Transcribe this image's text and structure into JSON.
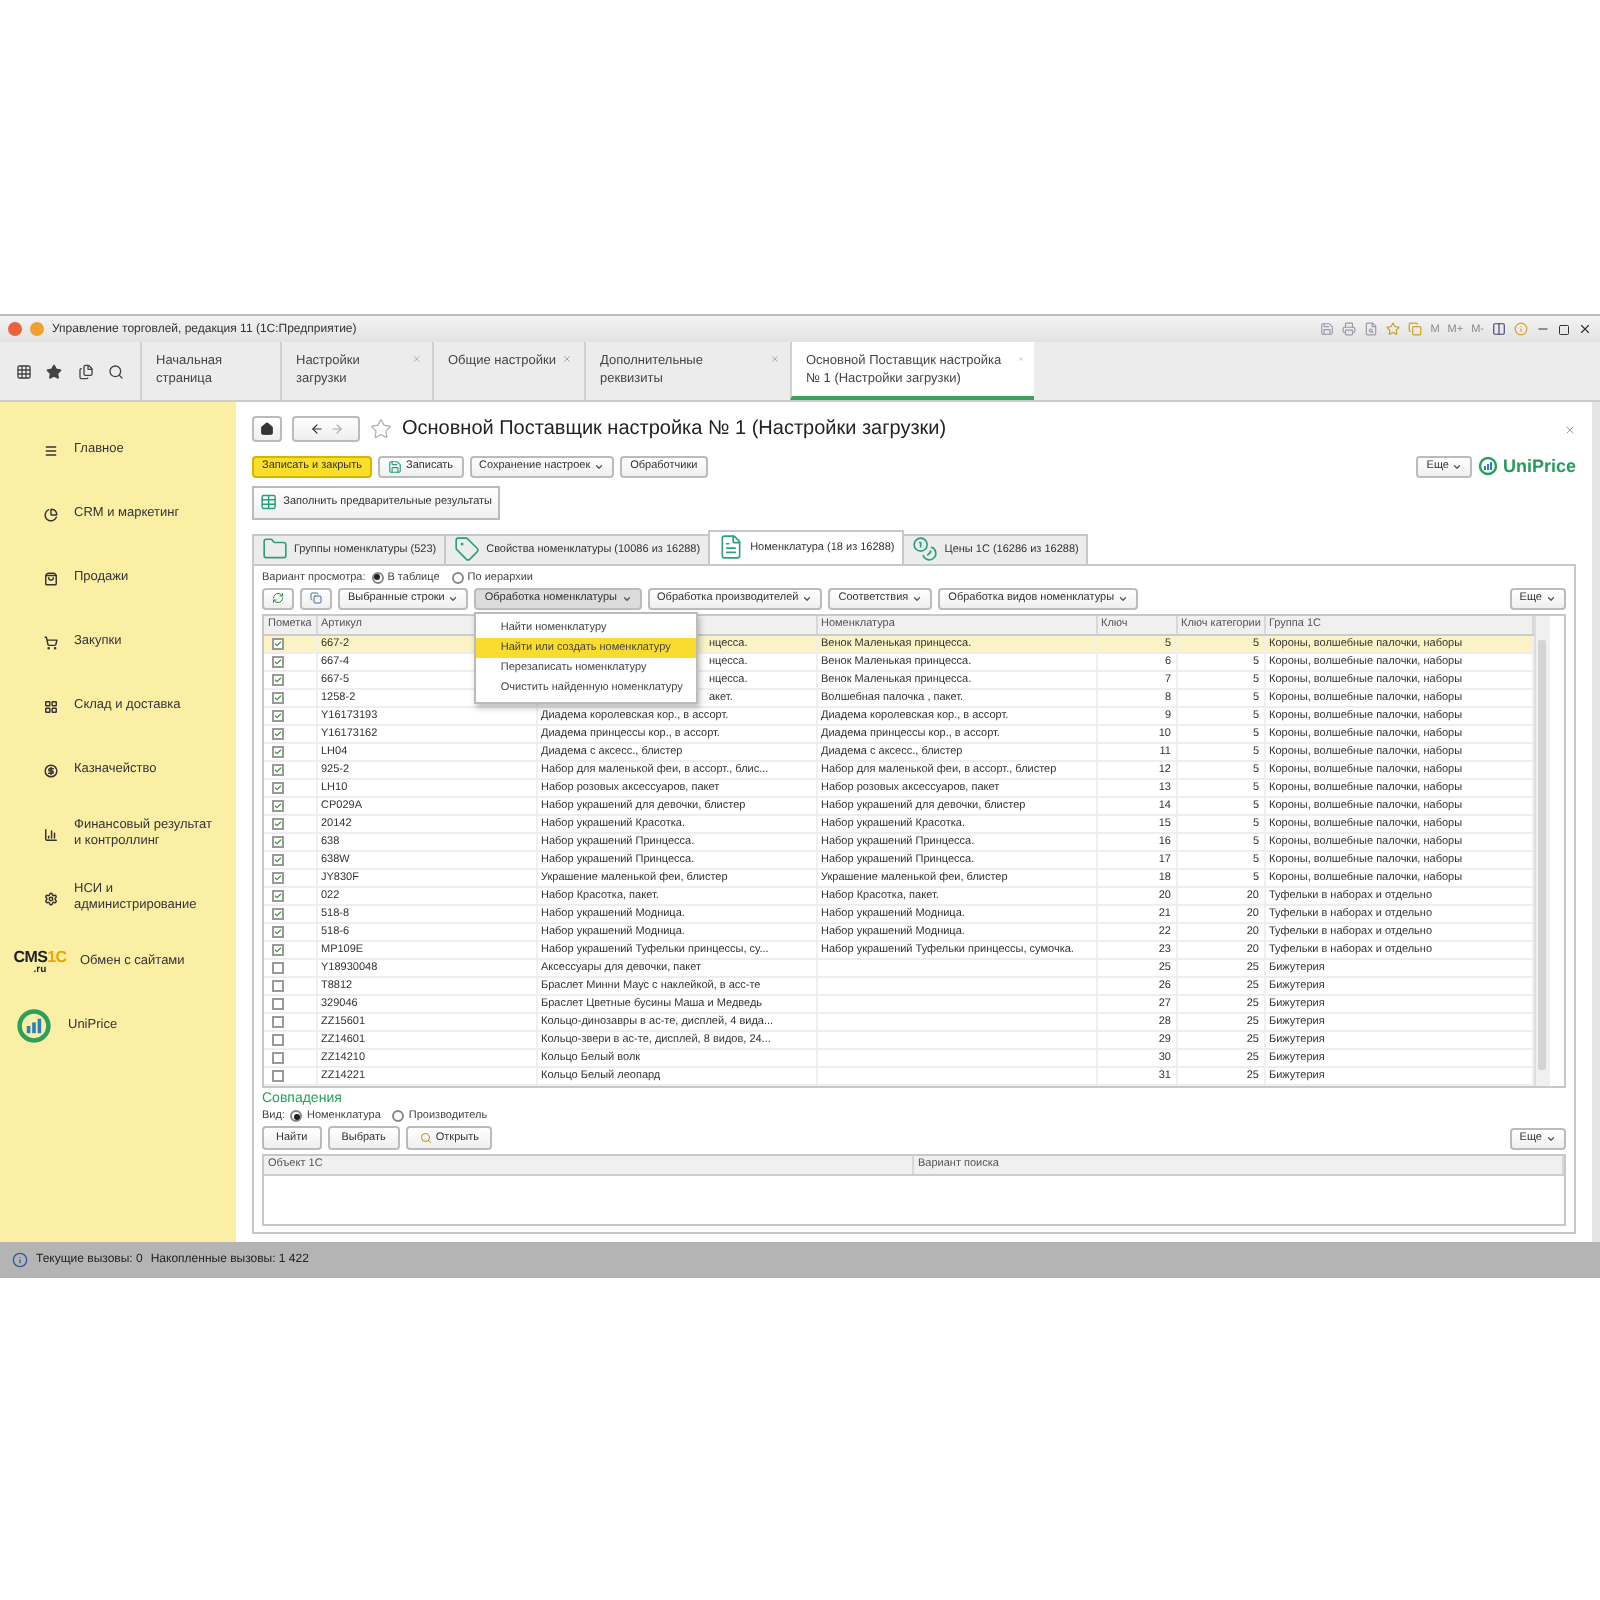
{
  "window": {
    "title": "Управление торговлей, редакция 11 (1С:Предприятие)",
    "memory_buttons": [
      "M",
      "M+",
      "M-"
    ]
  },
  "tabs": [
    {
      "label": "Начальная страница",
      "closable": false,
      "selected": false
    },
    {
      "label": "Настройки загрузки",
      "closable": true,
      "selected": false
    },
    {
      "label": "Общие настройки",
      "closable": true,
      "selected": false
    },
    {
      "label": "Дополнительные реквизиты",
      "closable": true,
      "selected": false
    },
    {
      "label": "Основной Поставщик настройка № 1 (Настройки загрузки)",
      "closable": true,
      "selected": true
    }
  ],
  "sidebar": {
    "items": [
      {
        "kind": "section",
        "label": "Главное"
      },
      {
        "kind": "section",
        "label": "CRM и маркетинг"
      },
      {
        "kind": "section",
        "label": "Продажи"
      },
      {
        "kind": "section",
        "label": "Закупки"
      },
      {
        "kind": "section",
        "label": "Склад и доставка"
      },
      {
        "kind": "section",
        "label": "Казначейство"
      },
      {
        "kind": "section",
        "label": "Финансовый результат и контроллинг"
      },
      {
        "kind": "section",
        "label": "НСИ и администрирование"
      },
      {
        "kind": "cms-logo",
        "label": "Обмен с сайтами",
        "logo": {
          "main": "CMS",
          "accent": "1C",
          "sub": ".ru"
        }
      },
      {
        "kind": "uniprice-logo",
        "label": "UniPrice"
      }
    ]
  },
  "form": {
    "title": "Основной Поставщик настройка № 1 (Настройки загрузки)",
    "toolbar": {
      "buttons": [
        {
          "kind": "primary",
          "label": "Записать и закрыть"
        },
        {
          "kind": "save",
          "label": "Записать"
        },
        {
          "kind": "dropdown",
          "label": "Сохранение настроек"
        },
        {
          "kind": "plain",
          "label": "Обработчики"
        }
      ],
      "more": "Еще",
      "brand": "UniPrice"
    },
    "fill_button": "Заполнить предварительные результаты",
    "tabs": [
      {
        "label": "Группы номенклатуры (523)",
        "selected": false
      },
      {
        "label": "Свойства номенклатуры (10086 из 16288)",
        "selected": false
      },
      {
        "label": "Номенклатура (18 из 16288)",
        "selected": true
      },
      {
        "label": "Цены 1С (16286 из 16288)",
        "selected": false
      }
    ],
    "view_mode": {
      "label": "Вариант просмотра:",
      "options": [
        {
          "label": "В таблице",
          "selected": true
        },
        {
          "label": "По иерархии",
          "selected": false
        }
      ]
    },
    "table_toolbar": {
      "menus": [
        {
          "label": "Выбранные строки",
          "pressed": false
        },
        {
          "label": "Обработка номенклатуры",
          "pressed": true
        },
        {
          "label": "Обработка производителей",
          "pressed": false
        },
        {
          "label": "Соответствия",
          "pressed": false
        },
        {
          "label": "Обработка видов номенклатуры",
          "pressed": false
        }
      ],
      "more": "Еще"
    },
    "menu": {
      "items": [
        {
          "label": "Найти номенклатуру",
          "selected": false
        },
        {
          "label": "Найти или создать номенклатуру",
          "selected": true
        },
        {
          "label": "Перезаписать номенклатуру",
          "selected": false
        },
        {
          "label": "Очистить найденную номенклатуру",
          "selected": false
        }
      ]
    },
    "table": {
      "columns": {
        "mark": "Пометка",
        "article": "Артикул",
        "nomenclature": "Номенклатура",
        "key": "Ключ",
        "category_key": "Ключ категории",
        "group": "Группа 1С"
      },
      "rows": [
        {
          "checked": true,
          "selected": true,
          "article": "667-2",
          "column_3": "нцесса.",
          "covered": true,
          "nomenclature": "Венок Маленькая принцесса.",
          "key": "5",
          "category_key": "5",
          "group": "Короны, волшебные палочки, наборы"
        },
        {
          "checked": true,
          "selected": false,
          "article": "667-4",
          "column_3": "нцесса.",
          "covered": true,
          "nomenclature": "Венок Маленькая принцесса.",
          "key": "6",
          "category_key": "5",
          "group": "Короны, волшебные палочки, наборы"
        },
        {
          "checked": true,
          "selected": false,
          "article": "667-5",
          "column_3": "нцесса.",
          "covered": true,
          "nomenclature": "Венок Маленькая принцесса.",
          "key": "7",
          "category_key": "5",
          "group": "Короны, волшебные палочки, наборы"
        },
        {
          "checked": true,
          "selected": false,
          "article": "1258-2",
          "column_3": "акет.",
          "covered": true,
          "nomenclature": "Волшебная палочка , пакет.",
          "key": "8",
          "category_key": "5",
          "group": "Короны, волшебные палочки, наборы"
        },
        {
          "checked": true,
          "selected": false,
          "article": "Y16173193",
          "column_3": "Диадема королевская кор., в ассорт.",
          "covered": false,
          "nomenclature": "Диадема королевская кор., в ассорт.",
          "key": "9",
          "category_key": "5",
          "group": "Короны, волшебные палочки, наборы"
        },
        {
          "checked": true,
          "selected": false,
          "article": "Y16173162",
          "column_3": "Диадема принцессы кор., в ассорт.",
          "covered": false,
          "nomenclature": "Диадема принцессы кор., в ассорт.",
          "key": "10",
          "category_key": "5",
          "group": "Короны, волшебные палочки, наборы"
        },
        {
          "checked": true,
          "selected": false,
          "article": "LH04",
          "column_3": "Диадема с аксесс., блистер",
          "covered": false,
          "nomenclature": "Диадема с аксесс., блистер",
          "key": "11",
          "category_key": "5",
          "group": "Короны, волшебные палочки, наборы"
        },
        {
          "checked": true,
          "selected": false,
          "article": "925-2",
          "column_3": "Набор для маленькой феи, в ассорт., блис...",
          "covered": false,
          "nomenclature": "Набор для маленькой феи, в ассорт., блистер",
          "key": "12",
          "category_key": "5",
          "group": "Короны, волшебные палочки, наборы"
        },
        {
          "checked": true,
          "selected": false,
          "article": "LH10",
          "column_3": "Набор розовых аксессуаров, пакет",
          "covered": false,
          "nomenclature": "Набор розовых аксессуаров, пакет",
          "key": "13",
          "category_key": "5",
          "group": "Короны, волшебные палочки, наборы"
        },
        {
          "checked": true,
          "selected": false,
          "article": "CP029A",
          "column_3": "Набор украшений для девочки, блистер",
          "covered": false,
          "nomenclature": "Набор украшений для девочки, блистер",
          "key": "14",
          "category_key": "5",
          "group": "Короны, волшебные палочки, наборы"
        },
        {
          "checked": true,
          "selected": false,
          "article": "20142",
          "column_3": "Набор украшений Красотка.",
          "covered": false,
          "nomenclature": "Набор украшений Красотка.",
          "key": "15",
          "category_key": "5",
          "group": "Короны, волшебные палочки, наборы"
        },
        {
          "checked": true,
          "selected": false,
          "article": "638",
          "column_3": "Набор украшений Принцесса.",
          "covered": false,
          "nomenclature": "Набор украшений Принцесса.",
          "key": "16",
          "category_key": "5",
          "group": "Короны, волшебные палочки, наборы"
        },
        {
          "checked": true,
          "selected": false,
          "article": "638W",
          "column_3": "Набор украшений Принцесса.",
          "covered": false,
          "nomenclature": "Набор украшений Принцесса.",
          "key": "17",
          "category_key": "5",
          "group": "Короны, волшебные палочки, наборы"
        },
        {
          "checked": true,
          "selected": false,
          "article": "JY830F",
          "column_3": "Украшение маленькой феи, блистер",
          "covered": false,
          "nomenclature": "Украшение маленькой феи, блистер",
          "key": "18",
          "category_key": "5",
          "group": "Короны, волшебные палочки, наборы"
        },
        {
          "checked": true,
          "selected": false,
          "article": "022",
          "column_3": "Набор Красотка, пакет.",
          "covered": false,
          "nomenclature": "Набор Красотка, пакет.",
          "key": "20",
          "category_key": "20",
          "group": "Туфельки в наборах и отдельно"
        },
        {
          "checked": true,
          "selected": false,
          "article": "518-8",
          "column_3": "Набор украшений Модница.",
          "covered": false,
          "nomenclature": "Набор украшений Модница.",
          "key": "21",
          "category_key": "20",
          "group": "Туфельки в наборах и отдельно"
        },
        {
          "checked": true,
          "selected": false,
          "article": "518-6",
          "column_3": "Набор украшений Модница.",
          "covered": false,
          "nomenclature": "Набор украшений Модница.",
          "key": "22",
          "category_key": "20",
          "group": "Туфельки в наборах и отдельно"
        },
        {
          "checked": true,
          "selected": false,
          "article": "MP109E",
          "column_3": "Набор украшений Туфельки принцессы, су...",
          "covered": false,
          "nomenclature": "Набор украшений Туфельки принцессы, сумочка.",
          "key": "23",
          "category_key": "20",
          "group": "Туфельки в наборах и отдельно"
        },
        {
          "checked": false,
          "selected": false,
          "article": "Y18930048",
          "column_3": "Аксессуары для девочки, пакет",
          "covered": false,
          "key": "25",
          "category_key": "25",
          "group": "Бижутерия"
        },
        {
          "checked": false,
          "selected": false,
          "article": "T8812",
          "column_3": "Браслет Минни Маус с наклейкой, в асс-те",
          "covered": false,
          "key": "26",
          "category_key": "25",
          "group": "Бижутерия"
        },
        {
          "checked": false,
          "selected": false,
          "article": "329046",
          "column_3": "Браслет Цветные бусины Маша и Медведь",
          "covered": false,
          "key": "27",
          "category_key": "25",
          "group": "Бижутерия"
        },
        {
          "checked": false,
          "selected": false,
          "article": "ZZ15601",
          "column_3": "Кольцо-динозавры в ас-те, дисплей, 4 вида...",
          "covered": false,
          "key": "28",
          "category_key": "25",
          "group": "Бижутерия"
        },
        {
          "checked": false,
          "selected": false,
          "article": "ZZ14601",
          "column_3": "Кольцо-звери в ас-те, дисплей, 8 видов, 24...",
          "covered": false,
          "key": "29",
          "category_key": "25",
          "group": "Бижутерия"
        },
        {
          "checked": false,
          "selected": false,
          "article": "ZZ14210",
          "column_3": "Кольцо Белый волк",
          "covered": false,
          "key": "30",
          "category_key": "25",
          "group": "Бижутерия"
        },
        {
          "checked": false,
          "selected": false,
          "article": "ZZ14221",
          "column_3": "Кольцо Белый леопард",
          "covered": false,
          "key": "31",
          "category_key": "25",
          "group": "Бижутерия"
        }
      ]
    },
    "matches": {
      "title": "Совпадения",
      "view_label": "Вид:",
      "options": [
        {
          "label": "Номенклатура",
          "selected": true
        },
        {
          "label": "Производитель",
          "selected": false
        }
      ],
      "buttons": [
        {
          "label": "Найти",
          "kind": "text"
        },
        {
          "label": "Выбрать",
          "kind": "text"
        },
        {
          "label": "Открыть",
          "kind": "search"
        }
      ],
      "more": "Еще",
      "columns": [
        "Объект 1С",
        "Вариант поиска"
      ]
    }
  },
  "status_bar": {
    "current_calls": "Текущие вызовы: 0",
    "total_calls": "Накопленные вызовы: 1 422"
  }
}
